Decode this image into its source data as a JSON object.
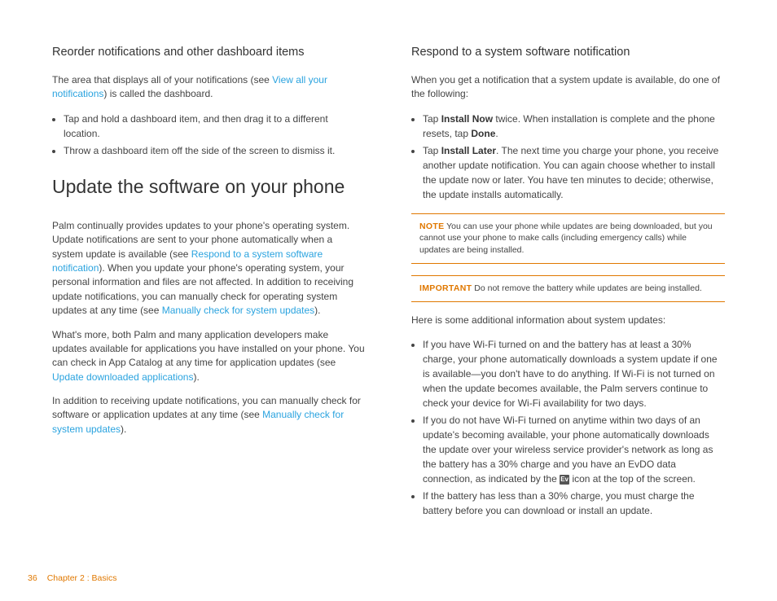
{
  "left": {
    "h3a": "Reorder notifications and other dashboard items",
    "p1a": "The area that displays all of your notifications (see ",
    "p1link": "View all your notifications",
    "p1b": ") is called the dashboard.",
    "li1": "Tap and hold a dashboard item, and then drag it to a different location.",
    "li2": "Throw a dashboard item off the side of the screen to dismiss it.",
    "h2": "Update the software on your phone",
    "p2a": "Palm continually provides updates to your phone's operating system. Update notifications are sent to your phone automatically when a system update is available (see ",
    "p2link": "Respond to a system software notification",
    "p2b": "). When you update your phone's operating system, your personal information and files are not affected. In addition to receiving update notifications, you can manually check for operating system updates at any time (see ",
    "p2link2": "Manually check for system updates",
    "p2c": ").",
    "p3a": "What's more, both Palm and many application developers make updates available for applications you have installed on your phone. You can check in App Catalog at any time for application updates (see ",
    "p3link": "Update downloaded applications",
    "p3b": ").",
    "p4a": "In addition to receiving update notifications, you can manually check for software or application updates at any time (see ",
    "p4link": "Manually check for system updates",
    "p4b": ")."
  },
  "right": {
    "h3": "Respond to a system software notification",
    "p1": "When you get a notification that a system update is available, do one of the following:",
    "li1a": "Tap ",
    "li1b1": "Install Now",
    "li1c": " twice. When installation is complete and the phone resets, tap ",
    "li1b2": "Done",
    "li1d": ".",
    "li2a": "Tap ",
    "li2b": "Install Later",
    "li2c": ". The next time you charge your phone, you receive another update notification. You can again choose whether to install the update now or later. You have ten minutes to decide; otherwise, the update installs automatically.",
    "note1label": "NOTE",
    "note1": "  You can use your phone while updates are being downloaded, but you cannot use your phone to make calls (including emergency calls) while updates are being installed.",
    "note2label": "IMPORTANT",
    "note2": "  Do not remove the battery while updates are being installed.",
    "p2": "Here is some additional information about system updates:",
    "li3": "If you have Wi-Fi turned on and the battery has at least a 30% charge, your phone automatically downloads a system update if one is available—you don't have to do anything. If Wi-Fi is not turned on when the update becomes available, the Palm servers continue to check your device for Wi-Fi availability for two days.",
    "li4a": "If you do not have Wi-Fi turned on anytime within two days of an update's becoming available, your phone automatically downloads the update over your wireless service provider's network as long as the battery has a 30% charge and you have an EvDO data connection, as indicated by the ",
    "li4b": " icon at the top of the screen.",
    "li5": "If the battery has less than a 30% charge, you must charge the battery before you can download or install an update.",
    "evicon": "Ev"
  },
  "footer": {
    "page": "36",
    "chapter": "Chapter 2 : Basics"
  }
}
